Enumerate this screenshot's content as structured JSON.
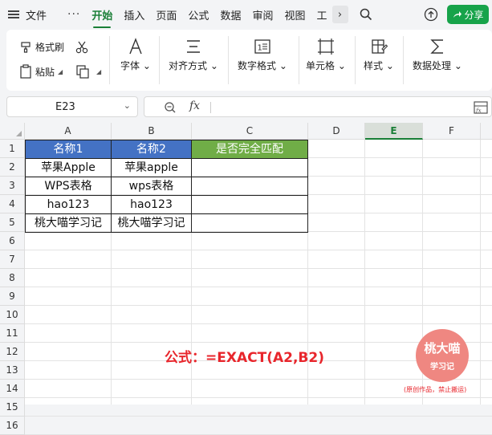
{
  "topbar": {
    "file_label": "文件",
    "tabs": [
      "开始",
      "插入",
      "页面",
      "公式",
      "数据",
      "审阅",
      "视图",
      "工"
    ],
    "active_tab": "开始",
    "share_label": "分享"
  },
  "ribbon": {
    "format_painter": "格式刷",
    "paste": "粘贴",
    "font": "字体",
    "align": "对齐方式",
    "number_format": "数字格式",
    "cell": "单元格",
    "style": "样式",
    "data_process": "数据处理"
  },
  "formula_bar": {
    "cell_ref": "E23",
    "fx_label": "fx",
    "value": ""
  },
  "sheet": {
    "columns": [
      "A",
      "B",
      "C",
      "D",
      "E",
      "F"
    ],
    "selected_column": "E",
    "rows": [
      "1",
      "2",
      "3",
      "4",
      "5",
      "6",
      "7",
      "8",
      "9",
      "10",
      "11",
      "12",
      "13",
      "14",
      "15",
      "16"
    ],
    "table": {
      "headers": [
        "名称1",
        "名称2",
        "是否完全匹配"
      ],
      "rows": [
        [
          "苹果Apple",
          "苹果apple",
          ""
        ],
        [
          "WPS表格",
          "wps表格",
          ""
        ],
        [
          "hao123",
          "hao123",
          ""
        ],
        [
          "桃大喵学习记",
          "桃大喵学习记",
          ""
        ]
      ],
      "header_colors": [
        "#4472c4",
        "#4472c4",
        "#70ad47"
      ]
    },
    "formula_note": "公式：=EXACT(A2,B2)"
  },
  "watermark": {
    "line1": "桃大喵",
    "line2": "学习记",
    "note": "(原创作品，禁止搬运)"
  }
}
